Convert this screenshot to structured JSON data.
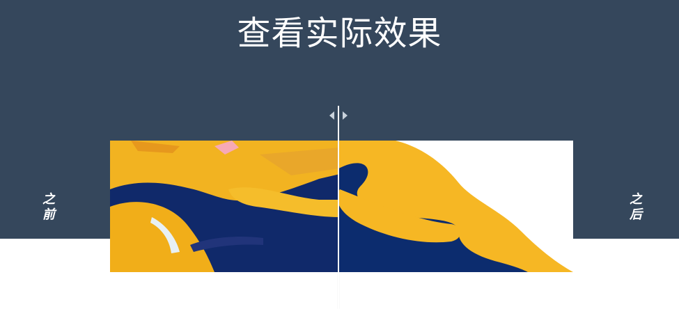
{
  "header": {
    "title": "查看实际效果"
  },
  "comparison": {
    "before_label": [
      "之",
      "前"
    ],
    "after_label": [
      "之",
      "后"
    ]
  },
  "colors": {
    "header_bg": "#35475c",
    "accent_yellow": "#f6b724",
    "accent_navy": "#0c2c6e"
  },
  "icons": {
    "handle": "left-right-arrows-icon"
  }
}
